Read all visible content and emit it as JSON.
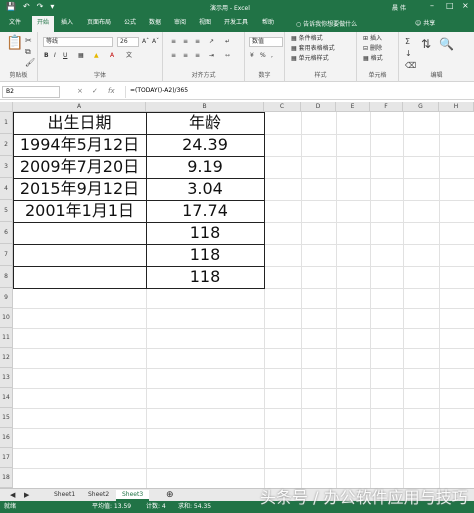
{
  "titlebar": {
    "doc_title": "演示用 - Excel",
    "user": "晨 伟"
  },
  "tabs": [
    "文件",
    "开始",
    "插入",
    "页面布局",
    "公式",
    "数据",
    "审阅",
    "视图",
    "开发工具",
    "帮助"
  ],
  "active_tab": "开始",
  "tell_me": "告诉我你想要做什么",
  "share": "共享",
  "ribbon": {
    "clipboard_label": "剪贴板",
    "font_label": "字体",
    "font_name": "等线",
    "font_size": "26",
    "align_label": "对齐方式",
    "number_label": "数字",
    "number_format": "数值",
    "styles_label": "样式",
    "cond_format": "条件格式",
    "table_format": "套用表格格式",
    "cell_styles": "单元格样式",
    "cells_label": "单元格",
    "insert": "插入",
    "delete": "删除",
    "format": "格式",
    "edit_label": "编辑"
  },
  "formula_bar": {
    "name_box": "B2",
    "formula": "=(TODAY()-A2)/365"
  },
  "columns": [
    "A",
    "B",
    "C",
    "D",
    "E",
    "F",
    "G",
    "H"
  ],
  "rows": [
    "1",
    "2",
    "3",
    "4",
    "5",
    "6",
    "7",
    "8",
    "9",
    "10",
    "11",
    "12",
    "13",
    "14",
    "15",
    "16",
    "17",
    "18",
    "19",
    "20"
  ],
  "table": {
    "headers": [
      "出生日期",
      "年龄"
    ],
    "rows": [
      [
        "1994年5月12日",
        "24.39"
      ],
      [
        "2009年7月20日",
        "9.19"
      ],
      [
        "2015年9月12日",
        "3.04"
      ],
      [
        "2001年1月1日",
        "17.74"
      ],
      [
        "",
        "118"
      ],
      [
        "",
        "118"
      ],
      [
        "",
        "118"
      ]
    ]
  },
  "sheets": [
    "Sheet1",
    "Sheet2",
    "Sheet3"
  ],
  "active_sheet": "Sheet3",
  "status": {
    "ready": "就绪",
    "average": "平均值: 13.59",
    "count": "计数: 4",
    "sum": "求和: 54.35"
  },
  "watermark": "头条号 / 办公软件应用与技巧"
}
